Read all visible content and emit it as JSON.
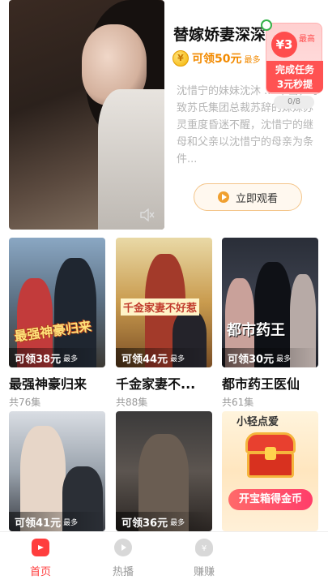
{
  "featured": {
    "title": "替嫁娇妻深深爱",
    "reward": "可领50元",
    "reward_suffix": "最多",
    "coin_symbol": "¥",
    "description": "沈惜宁的妹妹沈沐 ... 不当，导致苏氏集团总裁苏辞的妹妹苏灵重度昏迷不醒，沈惜宁的继母和父亲以沈惜宁的母亲为条件...",
    "watch_label": "立即观看"
  },
  "task": {
    "amount": "¥3",
    "max_label": "最高",
    "line1": "完成任务",
    "line2": "3元秒提",
    "progress": "0/8"
  },
  "dramas": [
    {
      "title": "最强神豪归来",
      "poster_text": "最强神豪归来",
      "episodes": "共76集",
      "bonus": "可领38元",
      "bonus_suffix": "最多"
    },
    {
      "title": "千金家妻不...",
      "poster_text": "千金家妻不好惹",
      "episodes": "共88集",
      "bonus": "可领44元",
      "bonus_suffix": "最多"
    },
    {
      "title": "都市药王医仙",
      "poster_text": "都市药王",
      "episodes": "共61集",
      "bonus": "可领30元",
      "bonus_suffix": "最多"
    },
    {
      "bonus": "可领41元",
      "bonus_suffix": "最多"
    },
    {
      "bonus": "可领36元",
      "bonus_suffix": "最多"
    }
  ],
  "treasure": {
    "top_text": "小轻点爱",
    "button": "开宝箱得金币"
  },
  "nav": [
    {
      "label": "首页",
      "icon": "home-tv-icon",
      "active": true
    },
    {
      "label": "热播",
      "icon": "play-circle-icon",
      "active": false
    },
    {
      "label": "赚赚",
      "icon": "money-bag-icon",
      "active": false
    }
  ],
  "colors": {
    "accent": "#ff4d4d",
    "reward_orange": "#f28a00",
    "nav_active": "#ff3d3d",
    "nav_inactive": "#999999"
  }
}
